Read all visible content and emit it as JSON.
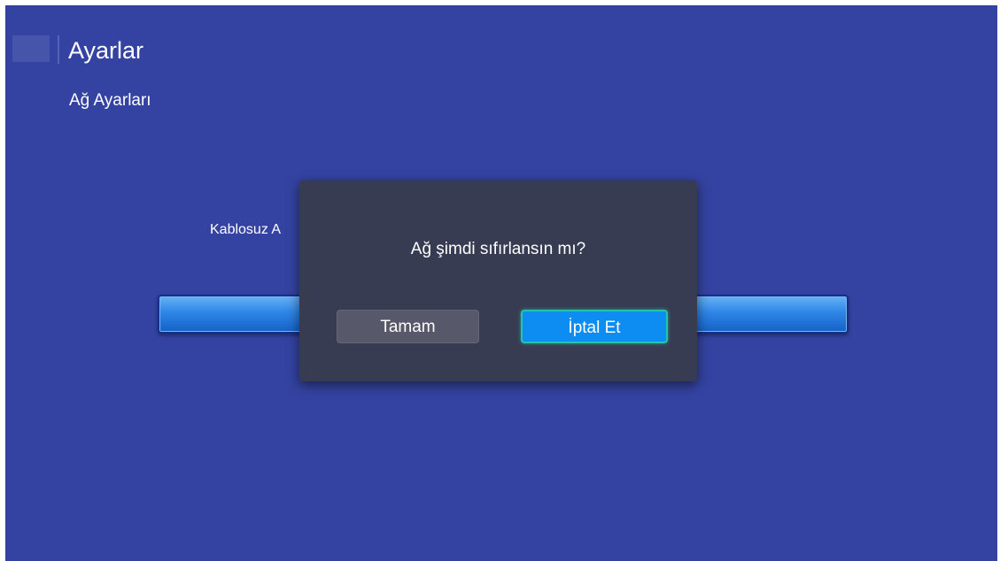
{
  "header": {
    "title": "Ayarlar"
  },
  "section": {
    "title": "Ağ Ayarları"
  },
  "background": {
    "wireless_label": "Kablosuz A"
  },
  "dialog": {
    "message": "Ağ şimdi sıfırlansın mı?",
    "ok_label": "Tamam",
    "cancel_label": "İptal Et",
    "focused_button": "cancel"
  },
  "colors": {
    "screen_background": "#3443a1",
    "dialog_background": "#373c53",
    "ok_button": "#57586a",
    "cancel_button": "#0d8cf2",
    "focus_outline": "#25c4ad"
  }
}
